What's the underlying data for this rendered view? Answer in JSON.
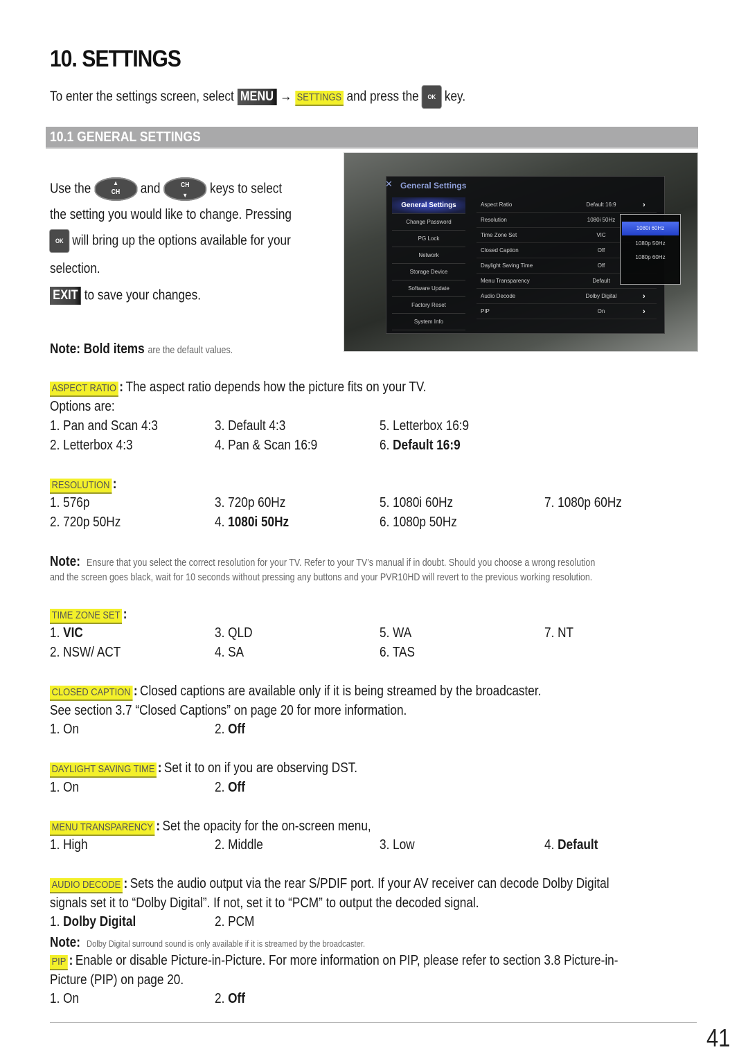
{
  "page": {
    "title": "10. SETTINGS",
    "page_number": "41"
  },
  "intro": {
    "prefix": "To enter the settings screen, select",
    "menu_key": "MENU",
    "arrow": "→",
    "settings_tag": "SETTINGS",
    "middle": "and press the",
    "ok_key": "OK",
    "suffix": "key."
  },
  "section": {
    "title": "10.1 GENERAL SETTINGS"
  },
  "instructions": {
    "use_the": "Use the",
    "ch_key_label": "CH",
    "and": "and",
    "keys_to_select": "keys to select",
    "line2": "the setting you would like to change. Pressing",
    "ok_key": "OK",
    "line3": "will bring up the options available for your",
    "line4": "selection.",
    "exit_key": "EXIT",
    "exit_text": "to save your changes.",
    "note_bold": "Note: Bold items",
    "note_rest": "are the default values."
  },
  "tv_screen": {
    "title": "General Settings",
    "left_menu": [
      "General Settings",
      "Change Password",
      "PG Lock",
      "Network",
      "Storage Device",
      "Software Update",
      "Factory Reset",
      "System Info"
    ],
    "left_selected": 0,
    "rows": [
      {
        "key": "Aspect Ratio",
        "value": "Default 16:9",
        "chevron": "›"
      },
      {
        "key": "Resolution",
        "value": "1080i 50Hz",
        "chevron": ""
      },
      {
        "key": "Time Zone Set",
        "value": "VIC",
        "chevron": ""
      },
      {
        "key": "Closed Caption",
        "value": "Off",
        "chevron": ""
      },
      {
        "key": "Daylight Saving Time",
        "value": "Off",
        "chevron": ""
      },
      {
        "key": "Menu Transparency",
        "value": "Default",
        "chevron": ""
      },
      {
        "key": "Audio Decode",
        "value": "Dolby Digital",
        "chevron": "›"
      },
      {
        "key": "PIP",
        "value": "On",
        "chevron": "›"
      }
    ],
    "popup_options": [
      "1080i 60Hz",
      "1080p 50Hz",
      "1080p 60Hz"
    ],
    "popup_selected": 0
  },
  "aspect_ratio": {
    "tag": "ASPECT RATIO",
    "desc": "The aspect ratio depends how the picture fits on your TV.",
    "options_label": "Options are:",
    "options": [
      {
        "num": "1.",
        "label": "Pan and Scan 4:3",
        "default": false
      },
      {
        "num": "2.",
        "label": "Letterbox 4:3",
        "default": false
      },
      {
        "num": "3.",
        "label": "Default 4:3",
        "default": false
      },
      {
        "num": "4.",
        "label": "Pan & Scan 16:9",
        "default": false
      },
      {
        "num": "5.",
        "label": "Letterbox 16:9",
        "default": false
      },
      {
        "num": "6.",
        "label": "Default 16:9",
        "default": true
      }
    ]
  },
  "resolution": {
    "tag": "RESOLUTION",
    "options": [
      {
        "num": "1.",
        "label": "576p",
        "default": false
      },
      {
        "num": "2.",
        "label": "720p 50Hz",
        "default": false
      },
      {
        "num": "3.",
        "label": "720p 60Hz",
        "default": false
      },
      {
        "num": "4.",
        "label": "1080i 50Hz",
        "default": true
      },
      {
        "num": "5.",
        "label": "1080i 60Hz",
        "default": false
      },
      {
        "num": "6.",
        "label": "1080p 50Hz",
        "default": false
      },
      {
        "num": "7.",
        "label": "1080p 60Hz",
        "default": false
      }
    ],
    "note_label": "Note:",
    "note_line1": "Ensure that you select the correct resolution for your TV. Refer to your TV’s manual if in doubt. Should you choose a wrong resolution",
    "note_line2": "and the screen goes black, wait for 10 seconds without pressing any buttons and your PVR10HD will revert to the previous working resolution."
  },
  "time_zone": {
    "tag": "TIME ZONE SET",
    "options": [
      {
        "num": "1.",
        "label": "VIC",
        "default": true
      },
      {
        "num": "2.",
        "label": "NSW/ ACT",
        "default": false
      },
      {
        "num": "3.",
        "label": "QLD",
        "default": false
      },
      {
        "num": "4.",
        "label": "SA",
        "default": false
      },
      {
        "num": "5.",
        "label": "WA",
        "default": false
      },
      {
        "num": "6.",
        "label": "TAS",
        "default": false
      },
      {
        "num": "7.",
        "label": "NT",
        "default": false
      }
    ]
  },
  "closed_caption": {
    "tag": "CLOSED CAPTION",
    "desc": "Closed captions are available only if it is being streamed by the broadcaster.",
    "desc2": "See section 3.7 “Closed Captions” on page 20 for more information.",
    "options": [
      {
        "num": "1.",
        "label": "On",
        "default": false
      },
      {
        "num": "2.",
        "label": "Off",
        "default": true
      }
    ]
  },
  "dst": {
    "tag": "DAYLIGHT SAVING TIME",
    "desc": "Set it to on if you are observing DST.",
    "options": [
      {
        "num": "1.",
        "label": "On",
        "default": false
      },
      {
        "num": "2.",
        "label": "Off",
        "default": true
      }
    ]
  },
  "menu_transparency": {
    "tag": "MENU TRANSPARENCY",
    "desc": "Set the opacity for the on-screen menu,",
    "options": [
      {
        "num": "1.",
        "label": "High",
        "default": false
      },
      {
        "num": "2.",
        "label": "Middle",
        "default": false
      },
      {
        "num": "3.",
        "label": "Low",
        "default": false
      },
      {
        "num": "4.",
        "label": "Default",
        "default": true
      }
    ]
  },
  "audio_decode": {
    "tag": "AUDIO DECODE",
    "desc": "Sets the audio output via the rear S/PDIF port. If your AV receiver can decode Dolby Digital",
    "desc2": "signals set it to “Dolby Digital”. If not, set it to “PCM” to output the decoded signal.",
    "options": [
      {
        "num": "1.",
        "label": "Dolby Digital",
        "default": true
      },
      {
        "num": "2.",
        "label": "PCM",
        "default": false
      }
    ],
    "note_label": "Note:",
    "note_text": "Dolby Digital surround sound is only available if it is streamed by the broadcaster."
  },
  "pip": {
    "tag": "PIP",
    "desc": "Enable or disable Picture-in-Picture. For more information on PIP, please refer to section 3.8 Picture-in-",
    "desc2": "Picture (PIP) on page 20.",
    "options": [
      {
        "num": "1.",
        "label": "On",
        "default": false
      },
      {
        "num": "2.",
        "label": "Off",
        "default": true
      }
    ]
  },
  "colors": {
    "highlight": "#f3f02a",
    "section_bar": "#a9a9aa",
    "key_dark": "#3a3a3a"
  }
}
